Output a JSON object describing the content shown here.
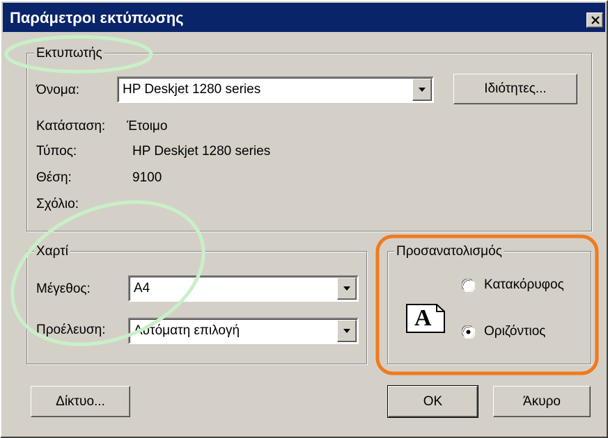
{
  "window": {
    "title": "Παράμετροι εκτύπωσης"
  },
  "printer": {
    "group_label": "Εκτυπωτής",
    "name_label": "Όνομα:",
    "name_value": "HP Deskjet 1280 series",
    "properties_button": "Ιδιότητες...",
    "status_label": "Κατάσταση:",
    "status_value": "Έτοιμο",
    "type_label": "Τύπος:",
    "type_value": "HP Deskjet 1280 series",
    "where_label": "Θέση:",
    "where_value": "9100",
    "comment_label": "Σχόλιο:",
    "comment_value": ""
  },
  "paper": {
    "group_label": "Χαρτί",
    "size_label": "Μέγεθος:",
    "size_value": "A4",
    "source_label": "Προέλευση:",
    "source_value": "Αυτόματη επιλογή"
  },
  "orientation": {
    "group_label": "Προσανατολισμός",
    "icon_letter": "A",
    "portrait_label": "Κατακόρυφος",
    "landscape_label": "Οριζόντιος",
    "selected": "landscape"
  },
  "buttons": {
    "network": "Δίκτυο...",
    "ok": "OK",
    "cancel": "Άκυρο"
  },
  "colors": {
    "titlebar": "#0a246a",
    "face": "#d4d0c8",
    "annotation_green": "#c8f0c8",
    "annotation_orange": "#f07a1e"
  }
}
